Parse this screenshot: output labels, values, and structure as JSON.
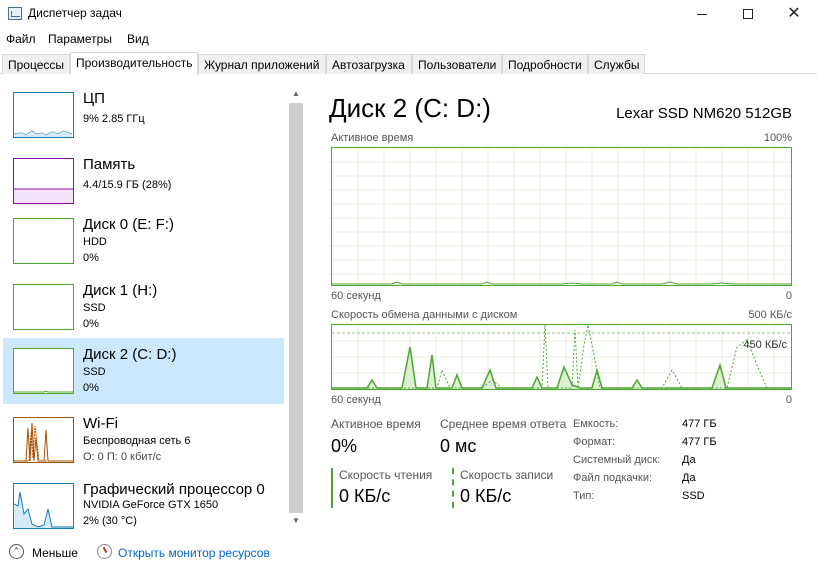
{
  "window": {
    "title": "Диспетчер задач",
    "minimize_glyph": "—",
    "close_glyph": "✕"
  },
  "menu": [
    {
      "label": "Файл"
    },
    {
      "label": "Параметры"
    },
    {
      "label": "Вид"
    }
  ],
  "tabs": [
    {
      "label": "Процессы",
      "active": false
    },
    {
      "label": "Производительность",
      "active": true
    },
    {
      "label": "Журнал приложений",
      "active": false
    },
    {
      "label": "Автозагрузка",
      "active": false
    },
    {
      "label": "Пользователи",
      "active": false
    },
    {
      "label": "Подробности",
      "active": false
    },
    {
      "label": "Службы",
      "active": false
    }
  ],
  "sidebar": {
    "items": [
      {
        "name": "ЦП",
        "line1": "9%  2.85 ГГц",
        "line2": "",
        "color": "#117dbb"
      },
      {
        "name": "Память",
        "line1": "4.4/15.9 ГБ (28%)",
        "line2": "",
        "color": "#8b12ae"
      },
      {
        "name": "Диск 0 (E: F:)",
        "line1": "HDD",
        "line2": "0%",
        "color": "#4ca72f"
      },
      {
        "name": "Диск 1 (H:)",
        "line1": "SSD",
        "line2": "0%",
        "color": "#4ca72f"
      },
      {
        "name": "Диск 2 (C: D:)",
        "line1": "SSD",
        "line2": "0%",
        "color": "#4ca72f",
        "selected": true
      },
      {
        "name": "Wi-Fi",
        "line1": "Беспроводная сеть 6",
        "line2": "О: 0 П: 0 кбит/с",
        "color": "#a74f01"
      },
      {
        "name": "Графический процессор 0",
        "line1": "NVIDIA GeForce GTX 1650",
        "line2": "2% (30 °C)",
        "color": "#117dbb"
      }
    ]
  },
  "detail": {
    "title": "Диск 2 (C: D:)",
    "model": "Lexar SSD NM620 512GB",
    "active_chart": {
      "label": "Активное время",
      "max_label": "100%",
      "time_label": "60 секунд",
      "min_label": "0"
    },
    "transfer_chart": {
      "label": "Скорость обмена данными с диском",
      "max_label": "500 КБ/с",
      "marker_label": "450 КБ/с",
      "time_label": "60 секунд",
      "min_label": "0"
    },
    "stats": {
      "active_time_label": "Активное время",
      "active_time_value": "0%",
      "response_label": "Среднее время ответа",
      "response_value": "0 мс",
      "read_label": "Скорость чтения",
      "read_value": "0 КБ/с",
      "write_label": "Скорость записи",
      "write_value": "0 КБ/с"
    },
    "properties": [
      {
        "label": "Емкость:",
        "value": "477 ГБ"
      },
      {
        "label": "Формат:",
        "value": "477 ГБ"
      },
      {
        "label": "Системный диск:",
        "value": "Да"
      },
      {
        "label": "Файл подкачки:",
        "value": "Да"
      },
      {
        "label": "Тип:",
        "value": "SSD"
      }
    ]
  },
  "footer": {
    "fewer_label": "Меньше",
    "monitor_label": "Открыть монитор ресурсов"
  },
  "colors": {
    "disk": "#4ca72f",
    "selected_bg": "#cce8ff",
    "link": "#0066cc"
  }
}
